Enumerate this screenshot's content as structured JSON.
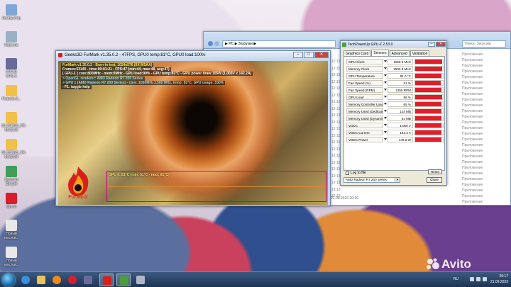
{
  "desktop": {
    "icons": [
      "Компьютер",
      "Корзина",
      "CPUID CPU-Z",
      "Plutonia-8...",
      "SIL2SENS_FR-MACON",
      "SIL2SENS_FR-MACON",
      "Бульгар Stream",
      "Opera",
      "Новый текстов...",
      "Новый текстов..."
    ]
  },
  "explorer": {
    "address": "▶ PC ▶ Загрузки ▶",
    "search_placeholder": "Поиск: Загрузки",
    "times": [
      "12:13",
      "12:13",
      "12:13",
      "12:13",
      "12:13",
      "12:13",
      "12:13",
      "12:13",
      "12:13",
      "12:13",
      "12:13",
      "12:13",
      "12:13",
      "12:13",
      "12:13",
      "12:13",
      "12:13",
      "12:13",
      "12:13",
      "12:13",
      "12:13"
    ],
    "file_types": [
      "Приложение",
      "Приложение",
      "Приложение",
      "Приложение",
      "Приложение",
      "Приложение",
      "Приложение",
      "Приложение",
      "Приложение",
      "Приложение",
      "Приложение",
      "Приложение",
      "Приложение",
      "Приложение",
      "Приложение",
      "Приложение",
      "Приложение",
      "Приложение",
      "Приложение",
      "Приложение",
      "Приложение",
      "Приложение",
      "Приложение",
      "Приложение",
      "Приложение",
      "Приложение",
      "Приложение"
    ],
    "datetime_text": "21.09.2023 20:10"
  },
  "furmark": {
    "title": "Geeks3D FurMark v1.35.0.2 - 47FPS, GPU0 temp:81°C, GPU0 load:100%",
    "osd_lines": [
      {
        "cls": "y b",
        "text": "FurMark v1.35.0.2 - Burn-in test, 1024x576 (0X MSAA)"
      },
      {
        "cls": "w b",
        "text": "Frames:53145 - time:00:01:21 - FPS:47 (min:44, max:48, avg:47)"
      },
      {
        "cls": "w b",
        "text": "[ GPU-Z ] core:800MHz - mem:0MHz - GPU load:99% - GPU temp:81°C - GPU power draw:105W (1.000V x 142.2A)"
      },
      {
        "cls": "c b",
        "text": "> OpenGL renderer: AMD Radeon R7 200 Series"
      },
      {
        "cls": "c b",
        "text": "> GPU 1 (AMD Radeon R7 200 Series) - core: 1050MHz:1500 MHz, temp: 81°C, GPU usage: 100%"
      },
      {
        "cls": "w b",
        "text": "- F1: toggle help"
      }
    ],
    "graph_label": "GPU 0: 81°C (min: 51°C - max: 81°C)",
    "logo_text": "FurMark"
  },
  "gpuz": {
    "title": "TechPowerUp GPU-Z 2.53.0",
    "tabs": [
      "Graphics Card",
      "Sensors",
      "Advanced",
      "Validation"
    ],
    "sensors": [
      {
        "name": "GPU Clock",
        "value": "1050.0 MHz",
        "fill": 0.97
      },
      {
        "name": "Memory Clock",
        "value": "1500.0 MHz",
        "fill": 0.97
      },
      {
        "name": "GPU Temperature",
        "value": "81.0 °C",
        "fill": 0.95
      },
      {
        "name": "Fan Speed (%)",
        "value": "51 %",
        "fill": 0.93
      },
      {
        "name": "Fan Speed (RPM)",
        "value": "1355 RPM",
        "fill": 0.95
      },
      {
        "name": "GPU Load",
        "value": "96 %",
        "fill": 0.97
      },
      {
        "name": "Memory Controller Load",
        "value": "65 %",
        "fill": 0.96
      },
      {
        "name": "Memory Used (Dedicated)",
        "value": "124 MB",
        "fill": 0.96
      },
      {
        "name": "Memory Used (Dynamic)",
        "value": "51 MB",
        "fill": 0.95
      },
      {
        "name": "VDDC",
        "value": "1.050 V",
        "fill": 0.95
      },
      {
        "name": "VDDC Current",
        "value": "142.2 A",
        "fill": 0.96
      },
      {
        "name": "VDDC Power",
        "value": "149.6 W",
        "fill": 0.96
      }
    ],
    "log_label": "Log to file",
    "reset_label": "Reset",
    "device": "AMD Radeon R7 200 Series",
    "close_label": "Close"
  },
  "taskbar": {
    "lang": "RU",
    "time": "20:17",
    "date": "21.09.2023"
  },
  "watermark": "Avito"
}
